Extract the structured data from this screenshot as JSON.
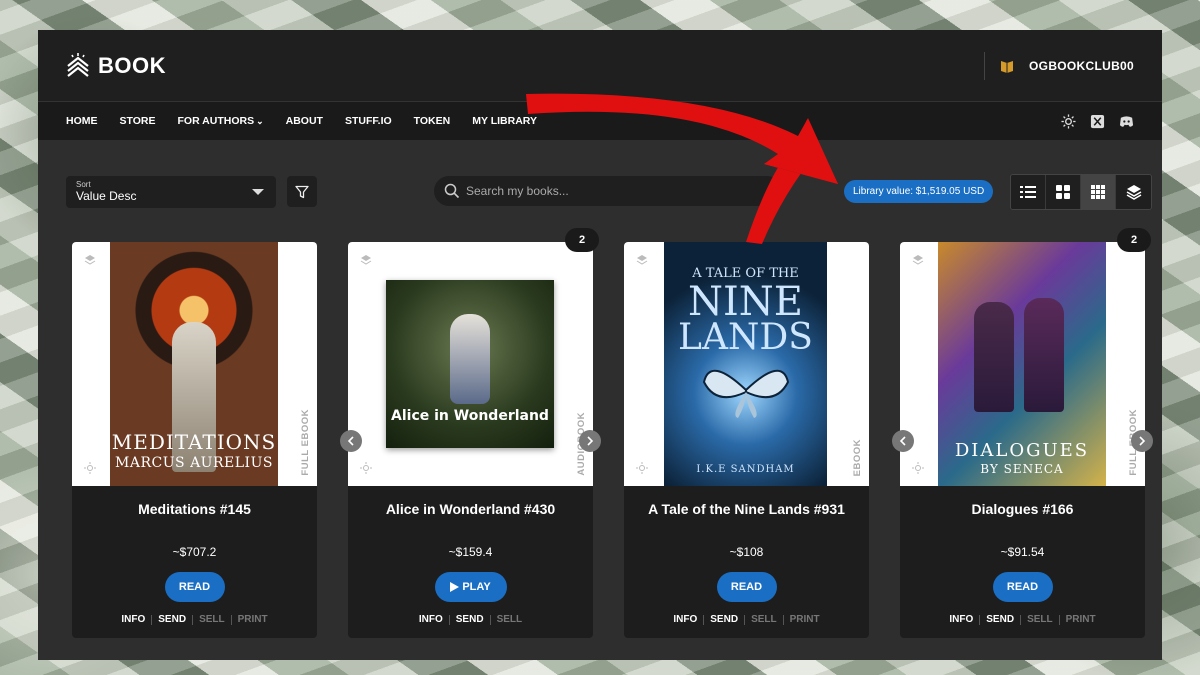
{
  "app": {
    "logo_text": "BOOK",
    "username": "OGBOOKCLUB00"
  },
  "nav": {
    "items": [
      "HOME",
      "STORE",
      "FOR AUTHORS",
      "ABOUT",
      "STUFF.IO",
      "TOKEN",
      "MY LIBRARY"
    ],
    "for_authors_caret": "⌄"
  },
  "controls": {
    "sort_label": "Sort",
    "sort_value": "Value Desc",
    "search_placeholder": "Search my books...",
    "library_value": "Library value: $1,519.05 USD"
  },
  "cards": [
    {
      "name": "Meditations #145",
      "price": "~$707.2",
      "button": "READ",
      "format": "FULL EBOOK",
      "cover_title": "MEDITATIONS",
      "cover_subtitle": "MARCUS AURELIUS",
      "actions": [
        "INFO",
        "SEND",
        "SELL",
        "PRINT"
      ]
    },
    {
      "name": "Alice in Wonderland #430",
      "price": "~$159.4",
      "button": "PLAY",
      "format": "AUDIOBOOK",
      "badge": "2",
      "cover_title": "Alice in Wonderland",
      "actions": [
        "INFO",
        "SEND",
        "SELL"
      ]
    },
    {
      "name": "A Tale of the Nine Lands #931",
      "price": "~$108",
      "button": "READ",
      "format": "EBOOK",
      "cover_title_small": "A TALE OF THE",
      "cover_title_big1": "NINE",
      "cover_title_big2": "LANDS",
      "cover_author": "I.K.E SANDHAM",
      "actions": [
        "INFO",
        "SEND",
        "SELL",
        "PRINT"
      ]
    },
    {
      "name": "Dialogues #166",
      "price": "~$91.54",
      "button": "READ",
      "format": "FULL EBOOK",
      "badge": "2",
      "cover_title": "DIALOGUES",
      "cover_subtitle": "BY SENECA",
      "actions": [
        "INFO",
        "SEND",
        "SELL",
        "PRINT"
      ]
    }
  ],
  "colors": {
    "accent": "#1a6fc4",
    "arrow": "#e01010"
  }
}
